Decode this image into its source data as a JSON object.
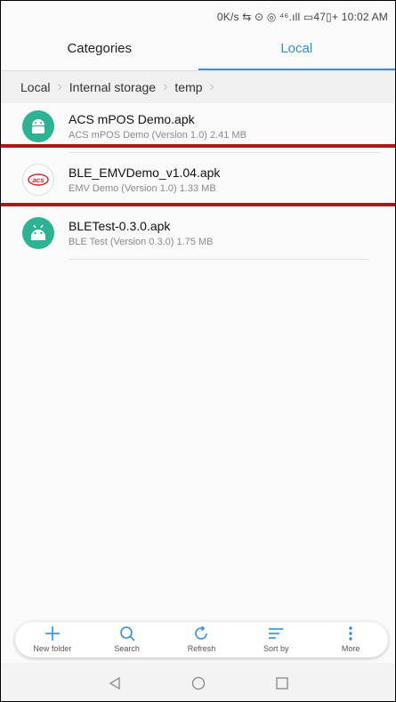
{
  "status_bar": {
    "text": "0K/s ⇆ ⊙ ◎ ⁴⁶.ıll ▭47▯+ 10:02 AM"
  },
  "tabs": [
    {
      "label": "Categories",
      "active": false
    },
    {
      "label": "Local",
      "active": true
    }
  ],
  "breadcrumb": {
    "items": [
      "Local",
      "Internal storage",
      "temp"
    ]
  },
  "files": [
    {
      "name": "ACS mPOS Demo.apk",
      "meta": "ACS mPOS Demo (Version 1.0) 2.41 MB",
      "icon": "android-icon"
    },
    {
      "name": "BLE_EMVDemo_v1.04.apk",
      "meta": "EMV Demo (Version 1.0) 1.33 MB",
      "icon": "acs-logo-icon"
    },
    {
      "name": "BLETest-0.3.0.apk",
      "meta": "BLE Test (Version 0.3.0) 1.75 MB",
      "icon": "android-icon"
    }
  ],
  "acs_logo_text": "acs",
  "toolbar": {
    "new_folder": "New folder",
    "search": "Search",
    "refresh": "Refresh",
    "sort_by": "Sort by",
    "more": "More"
  },
  "colors": {
    "accent": "#2f8fe0",
    "android": "#2db394",
    "highlight_line": "#b0151a",
    "acs_red": "#d22b2b"
  }
}
